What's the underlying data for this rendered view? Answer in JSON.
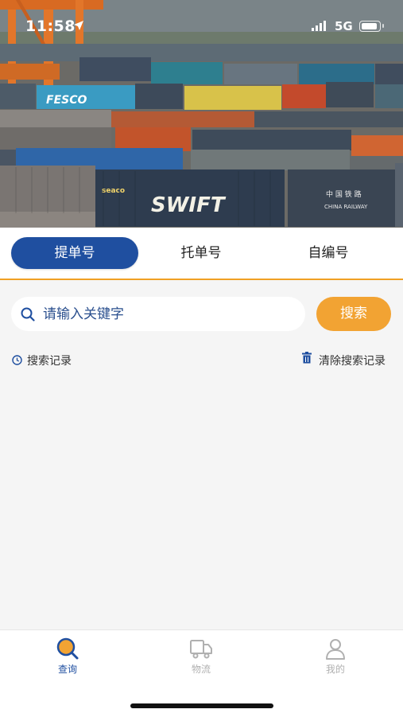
{
  "status_bar": {
    "time": "11:58",
    "network": "5G",
    "icons": [
      "location-arrow-icon",
      "signal-icon",
      "battery-icon"
    ]
  },
  "hero": {
    "container_brands": [
      "SWIFT",
      "seaco",
      "中国铁路",
      "CHINA RAILWAY"
    ]
  },
  "tabs": [
    {
      "label": "提单号",
      "active": true
    },
    {
      "label": "托单号",
      "active": false
    },
    {
      "label": "自编号",
      "active": false
    }
  ],
  "search": {
    "placeholder": "请输入关键字",
    "button_label": "搜索",
    "icon": "search-icon"
  },
  "history": {
    "label": "搜索记录",
    "clear_label": "清除搜索记录",
    "icons": [
      "clock-icon",
      "trash-icon"
    ]
  },
  "bottom_nav": [
    {
      "label": "查询",
      "icon": "search-nav-icon",
      "active": true
    },
    {
      "label": "物流",
      "icon": "truck-icon",
      "active": false
    },
    {
      "label": "我的",
      "icon": "user-icon",
      "active": false
    }
  ],
  "colors": {
    "primary": "#1f4fa0",
    "accent": "#f2a333",
    "background": "#f5f5f5"
  }
}
